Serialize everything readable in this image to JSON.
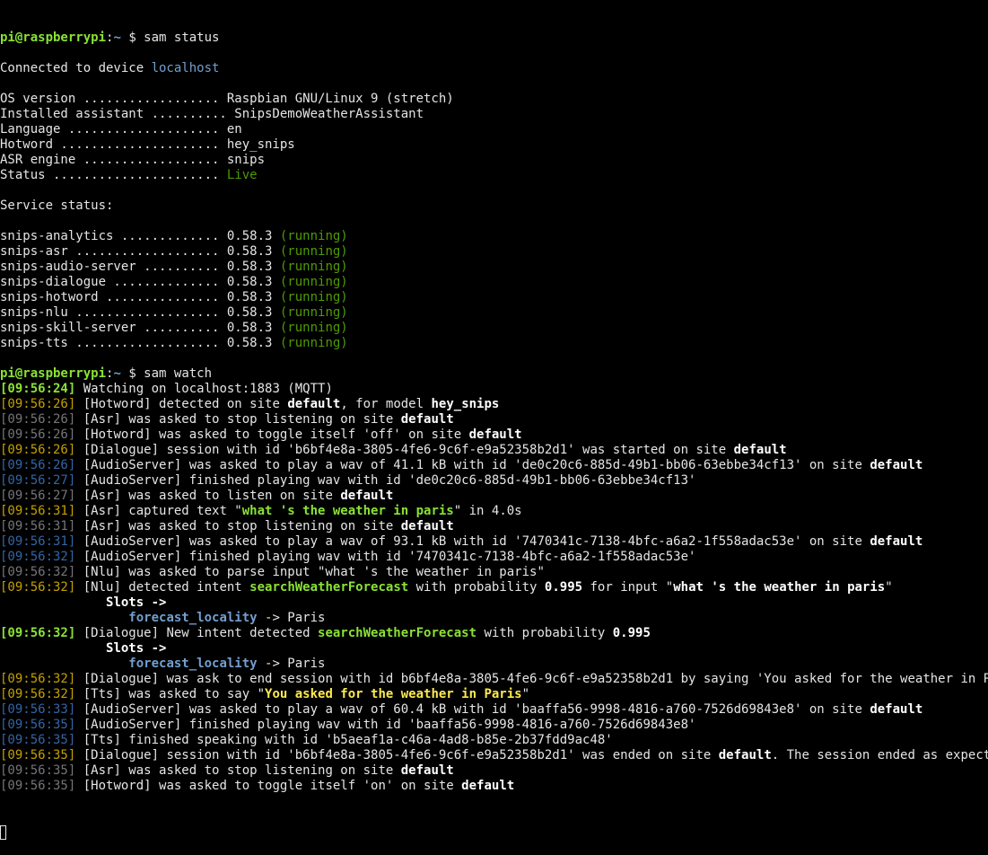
{
  "colors": {
    "background": "#000000",
    "text": "#e5e5e5",
    "prompt_user": "#8ae234",
    "prompt_path": "#729fcf",
    "timestamp_yellow": "#c4a000",
    "timestamp_gray": "#75757a",
    "timestamp_blue": "#3465a4",
    "running": "#4e9a06"
  },
  "terminal": {
    "lines": [
      [
        {
          "t": "pi@raspberrypi",
          "c": "prompt_user"
        },
        {
          "t": ":",
          "c": "normal"
        },
        {
          "t": "~",
          "c": "prompt_path"
        },
        {
          "t": " $ sam status",
          "c": "normal"
        }
      ],
      [],
      [
        {
          "t": "Connected to device ",
          "c": "normal"
        },
        {
          "t": "localhost",
          "c": "host"
        }
      ],
      [],
      [
        {
          "t": "OS version .................. Raspbian GNU/Linux 9 (stretch)",
          "c": "normal"
        }
      ],
      [
        {
          "t": "Installed assistant .......... SnipsDemoWeatherAssistant",
          "c": "normal"
        }
      ],
      [
        {
          "t": "Language .................... en",
          "c": "normal"
        }
      ],
      [
        {
          "t": "Hotword ..................... hey_snips",
          "c": "normal"
        }
      ],
      [
        {
          "t": "ASR engine .................. snips",
          "c": "normal"
        }
      ],
      [
        {
          "t": "Status ...................... ",
          "c": "normal"
        },
        {
          "t": "Live",
          "c": "live"
        }
      ],
      [],
      [
        {
          "t": "Service status:",
          "c": "normal"
        }
      ],
      [],
      [
        {
          "t": "snips-analytics ............. 0.58.3 ",
          "c": "normal"
        },
        {
          "t": "(running)",
          "c": "running"
        }
      ],
      [
        {
          "t": "snips-asr ................... 0.58.3 ",
          "c": "normal"
        },
        {
          "t": "(running)",
          "c": "running"
        }
      ],
      [
        {
          "t": "snips-audio-server .......... 0.58.3 ",
          "c": "normal"
        },
        {
          "t": "(running)",
          "c": "running"
        }
      ],
      [
        {
          "t": "snips-dialogue .............. 0.58.3 ",
          "c": "normal"
        },
        {
          "t": "(running)",
          "c": "running"
        }
      ],
      [
        {
          "t": "snips-hotword ............... 0.58.3 ",
          "c": "normal"
        },
        {
          "t": "(running)",
          "c": "running"
        }
      ],
      [
        {
          "t": "snips-nlu ................... 0.58.3 ",
          "c": "normal"
        },
        {
          "t": "(running)",
          "c": "running"
        }
      ],
      [
        {
          "t": "snips-skill-server .......... 0.58.3 ",
          "c": "normal"
        },
        {
          "t": "(running)",
          "c": "running"
        }
      ],
      [
        {
          "t": "snips-tts ................... 0.58.3 ",
          "c": "normal"
        },
        {
          "t": "(running)",
          "c": "running"
        }
      ],
      [],
      [
        {
          "t": "pi@raspberrypi",
          "c": "prompt_user"
        },
        {
          "t": ":",
          "c": "normal"
        },
        {
          "t": "~",
          "c": "prompt_path"
        },
        {
          "t": " $ sam watch",
          "c": "normal"
        }
      ],
      [
        {
          "t": "[09:56:24]",
          "c": "ts_green_bold"
        },
        {
          "t": " Watching on localhost:1883 (MQTT)",
          "c": "normal"
        }
      ],
      [
        {
          "t": "[09:56:26]",
          "c": "ts_yellow"
        },
        {
          "t": " [Hotword] detected on site ",
          "c": "normal"
        },
        {
          "t": "default",
          "c": "bold"
        },
        {
          "t": ", for model ",
          "c": "normal"
        },
        {
          "t": "hey_snips",
          "c": "bold"
        }
      ],
      [
        {
          "t": "[09:56:26]",
          "c": "ts_gray"
        },
        {
          "t": " [Asr] was asked to stop listening on site ",
          "c": "normal"
        },
        {
          "t": "default",
          "c": "bold"
        }
      ],
      [
        {
          "t": "[09:56:26]",
          "c": "ts_gray"
        },
        {
          "t": " [Hotword] was asked to toggle itself 'off' on site ",
          "c": "normal"
        },
        {
          "t": "default",
          "c": "bold"
        }
      ],
      [
        {
          "t": "[09:56:26]",
          "c": "ts_yellow"
        },
        {
          "t": " [Dialogue] session with id 'b6bf4e8a-3805-4fe6-9c6f-e9a52358b2d1' was started on site ",
          "c": "normal"
        },
        {
          "t": "default",
          "c": "bold"
        }
      ],
      [
        {
          "t": "[09:56:26]",
          "c": "ts_blue"
        },
        {
          "t": " [AudioServer] was asked to play a wav of 41.1 kB with id 'de0c20c6-885d-49b1-bb06-63ebbe34cf13' on site ",
          "c": "normal"
        },
        {
          "t": "default",
          "c": "bold"
        }
      ],
      [
        {
          "t": "[09:56:27]",
          "c": "ts_blue"
        },
        {
          "t": " [AudioServer] finished playing wav with id 'de0c20c6-885d-49b1-bb06-63ebbe34cf13'",
          "c": "normal"
        }
      ],
      [
        {
          "t": "[09:56:27]",
          "c": "ts_gray"
        },
        {
          "t": " [Asr] was asked to listen on site ",
          "c": "normal"
        },
        {
          "t": "default",
          "c": "bold"
        }
      ],
      [
        {
          "t": "[09:56:31]",
          "c": "ts_yellow"
        },
        {
          "t": " [Asr] captured text \"",
          "c": "normal"
        },
        {
          "t": "what 's the weather in paris",
          "c": "green_bold"
        },
        {
          "t": "\" in 4.0s",
          "c": "normal"
        }
      ],
      [
        {
          "t": "[09:56:31]",
          "c": "ts_gray"
        },
        {
          "t": " [Asr] was asked to stop listening on site ",
          "c": "normal"
        },
        {
          "t": "default",
          "c": "bold"
        }
      ],
      [
        {
          "t": "[09:56:31]",
          "c": "ts_blue"
        },
        {
          "t": " [AudioServer] was asked to play a wav of 93.1 kB with id '7470341c-7138-4bfc-a6a2-1f558adac53e' on site ",
          "c": "normal"
        },
        {
          "t": "default",
          "c": "bold"
        }
      ],
      [
        {
          "t": "[09:56:32]",
          "c": "ts_blue"
        },
        {
          "t": " [AudioServer] finished playing wav with id '7470341c-7138-4bfc-a6a2-1f558adac53e'",
          "c": "normal"
        }
      ],
      [
        {
          "t": "[09:56:32]",
          "c": "ts_gray"
        },
        {
          "t": " [Nlu] was asked to parse input \"what 's the weather in paris\"",
          "c": "normal"
        }
      ],
      [
        {
          "t": "[09:56:32]",
          "c": "ts_yellow"
        },
        {
          "t": " [Nlu] detected intent ",
          "c": "normal"
        },
        {
          "t": "searchWeatherForecast",
          "c": "green_bold"
        },
        {
          "t": " with probability ",
          "c": "normal"
        },
        {
          "t": "0.995",
          "c": "bold"
        },
        {
          "t": " for input \"",
          "c": "normal"
        },
        {
          "t": "what 's the weather in paris",
          "c": "bold"
        },
        {
          "t": "\"",
          "c": "normal"
        }
      ],
      [
        {
          "t": "              ",
          "c": "normal"
        },
        {
          "t": "Slots ->",
          "c": "bold"
        }
      ],
      [
        {
          "t": "                 ",
          "c": "normal"
        },
        {
          "t": "forecast_locality",
          "c": "cyan_bold"
        },
        {
          "t": " -> Paris",
          "c": "normal"
        }
      ],
      [
        {
          "t": "[09:56:32]",
          "c": "ts_green_bold"
        },
        {
          "t": " [Dialogue] New intent detected ",
          "c": "normal"
        },
        {
          "t": "searchWeatherForecast",
          "c": "green_bold"
        },
        {
          "t": " with probability ",
          "c": "normal"
        },
        {
          "t": "0.995",
          "c": "bold"
        }
      ],
      [
        {
          "t": "              ",
          "c": "normal"
        },
        {
          "t": "Slots ->",
          "c": "bold"
        }
      ],
      [
        {
          "t": "                 ",
          "c": "normal"
        },
        {
          "t": "forecast_locality",
          "c": "cyan_bold"
        },
        {
          "t": " -> Paris",
          "c": "normal"
        }
      ],
      [
        {
          "t": "[09:56:32]",
          "c": "ts_yellow"
        },
        {
          "t": " [Dialogue] was ask to end session with id b6bf4e8a-3805-4fe6-9c6f-e9a52358b2d1 by saying 'You asked for the weather in Paris'",
          "c": "normal"
        }
      ],
      [
        {
          "t": "[09:56:32]",
          "c": "ts_yellow"
        },
        {
          "t": " [Tts] was asked to say \"",
          "c": "normal"
        },
        {
          "t": "You asked for the weather in Paris",
          "c": "yellow_bold"
        },
        {
          "t": "\"",
          "c": "normal"
        }
      ],
      [
        {
          "t": "[09:56:33]",
          "c": "ts_blue"
        },
        {
          "t": " [AudioServer] was asked to play a wav of 60.4 kB with id 'baaffa56-9998-4816-a760-7526d69843e8' on site ",
          "c": "normal"
        },
        {
          "t": "default",
          "c": "bold"
        }
      ],
      [
        {
          "t": "[09:56:35]",
          "c": "ts_blue"
        },
        {
          "t": " [AudioServer] finished playing wav with id 'baaffa56-9998-4816-a760-7526d69843e8'",
          "c": "normal"
        }
      ],
      [
        {
          "t": "[09:56:35]",
          "c": "ts_blue"
        },
        {
          "t": " [Tts] finished speaking with id 'b5aeaf1a-c46a-4ad8-b85e-2b37fdd9ac48'",
          "c": "normal"
        }
      ],
      [
        {
          "t": "[09:56:35]",
          "c": "ts_yellow"
        },
        {
          "t": " [Dialogue] session with id 'b6bf4e8a-3805-4fe6-9c6f-e9a52358b2d1' was ended on site ",
          "c": "normal"
        },
        {
          "t": "default",
          "c": "bold"
        },
        {
          "t": ". The session ended as expected",
          "c": "normal"
        }
      ],
      [
        {
          "t": "[09:56:35]",
          "c": "ts_gray"
        },
        {
          "t": " [Asr] was asked to stop listening on site ",
          "c": "normal"
        },
        {
          "t": "default",
          "c": "bold"
        }
      ],
      [
        {
          "t": "[09:56:35]",
          "c": "ts_gray"
        },
        {
          "t": " [Hotword] was asked to toggle itself 'on' on site ",
          "c": "normal"
        },
        {
          "t": "default",
          "c": "bold"
        }
      ]
    ]
  }
}
